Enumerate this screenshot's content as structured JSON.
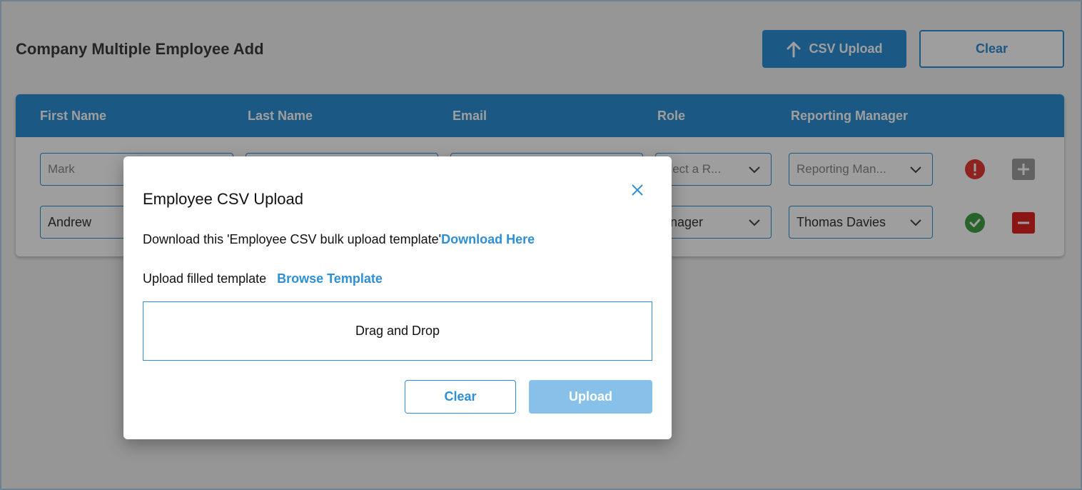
{
  "page": {
    "title": "Company Multiple Employee Add",
    "csv_upload_label": "CSV Upload",
    "clear_label": "Clear"
  },
  "table": {
    "headers": [
      "First Name",
      "Last Name",
      "Email",
      "Role",
      "Reporting Manager"
    ],
    "rows": [
      {
        "first_name": "Mark",
        "role_placeholder": "elect a R...",
        "reporting_manager_placeholder": "Reporting Man...",
        "status": "error",
        "action": "add"
      },
      {
        "first_name": "Andrew",
        "role": "anager",
        "reporting_manager": "Thomas Davies",
        "status": "ok",
        "action": "remove"
      }
    ]
  },
  "modal": {
    "title": "Employee CSV Upload",
    "download_text": "Download this 'Employee CSV bulk upload template'",
    "download_link": "Download Here",
    "upload_text": "Upload filled template",
    "browse_link": "Browse Template",
    "dropzone_text": "Drag and Drop",
    "clear_label": "Clear",
    "upload_label": "Upload"
  },
  "colors": {
    "primary": "#2e8fd6",
    "upload_disabled": "#87c1ea",
    "error": "#e53935",
    "success": "#43a047",
    "remove": "#e02424",
    "add": "#9e9e9e"
  }
}
